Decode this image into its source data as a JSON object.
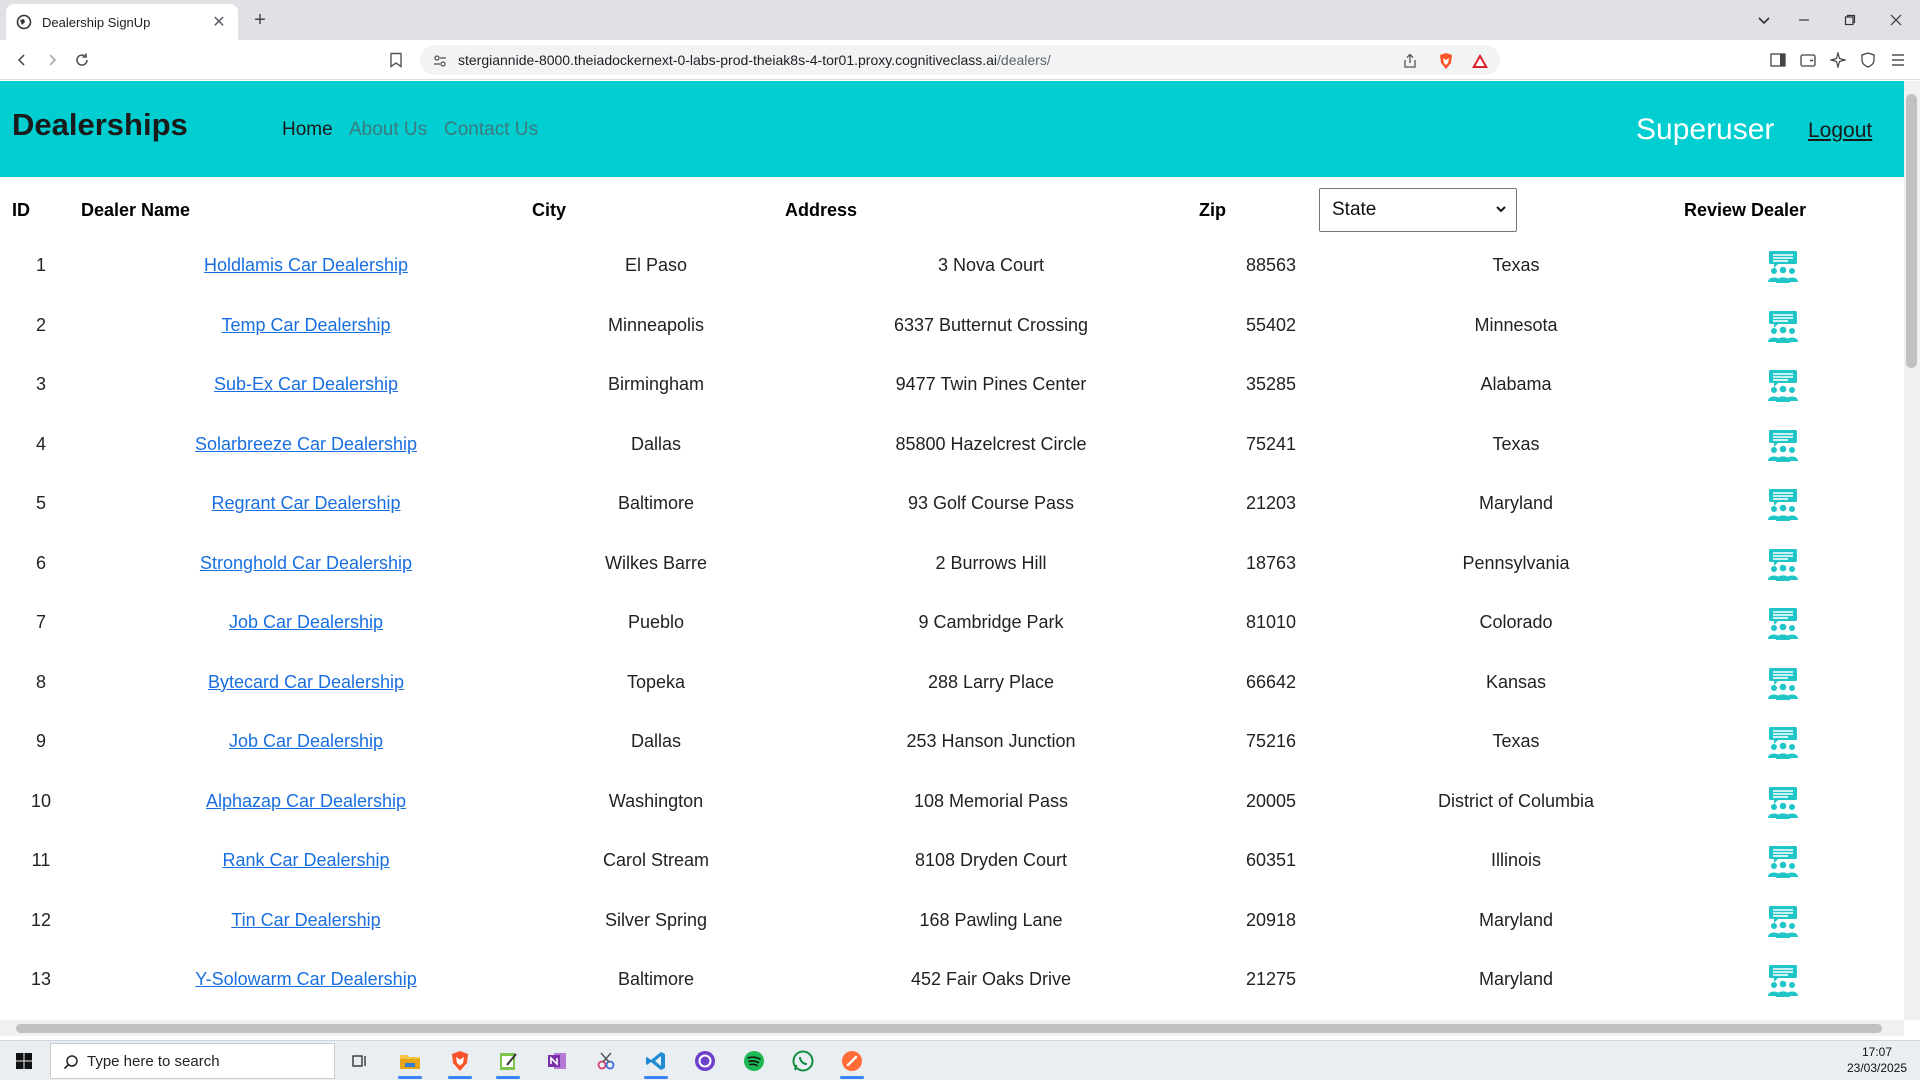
{
  "browser": {
    "tab_title": "Dealership SignUp",
    "url_host": "stergiannide-8000.theiadockernext-0-labs-prod-theiak8s-4-tor01.proxy.cognitiveclass.ai",
    "url_path": "/dealers/"
  },
  "header": {
    "brand": "Dealerships",
    "nav": [
      "Home",
      "About Us",
      "Contact Us"
    ],
    "user": "Superuser",
    "logout": "Logout",
    "bg_color": "#00ced1"
  },
  "table": {
    "headers": {
      "id": "ID",
      "name": "Dealer Name",
      "city": "City",
      "address": "Address",
      "zip": "Zip",
      "state_select": "State",
      "review": "Review Dealer"
    },
    "rows": [
      {
        "id": "1",
        "name": "Holdlamis Car Dealership",
        "city": "El Paso",
        "address": "3 Nova Court",
        "zip": "88563",
        "state": "Texas"
      },
      {
        "id": "2",
        "name": "Temp Car Dealership",
        "city": "Minneapolis",
        "address": "6337 Butternut Crossing",
        "zip": "55402",
        "state": "Minnesota"
      },
      {
        "id": "3",
        "name": "Sub-Ex Car Dealership",
        "city": "Birmingham",
        "address": "9477 Twin Pines Center",
        "zip": "35285",
        "state": "Alabama"
      },
      {
        "id": "4",
        "name": "Solarbreeze Car Dealership",
        "city": "Dallas",
        "address": "85800 Hazelcrest Circle",
        "zip": "75241",
        "state": "Texas"
      },
      {
        "id": "5",
        "name": "Regrant Car Dealership",
        "city": "Baltimore",
        "address": "93 Golf Course Pass",
        "zip": "21203",
        "state": "Maryland"
      },
      {
        "id": "6",
        "name": "Stronghold Car Dealership",
        "city": "Wilkes Barre",
        "address": "2 Burrows Hill",
        "zip": "18763",
        "state": "Pennsylvania"
      },
      {
        "id": "7",
        "name": "Job Car Dealership",
        "city": "Pueblo",
        "address": "9 Cambridge Park",
        "zip": "81010",
        "state": "Colorado"
      },
      {
        "id": "8",
        "name": "Bytecard Car Dealership",
        "city": "Topeka",
        "address": "288 Larry Place",
        "zip": "66642",
        "state": "Kansas"
      },
      {
        "id": "9",
        "name": "Job Car Dealership",
        "city": "Dallas",
        "address": "253 Hanson Junction",
        "zip": "75216",
        "state": "Texas"
      },
      {
        "id": "10",
        "name": "Alphazap Car Dealership",
        "city": "Washington",
        "address": "108 Memorial Pass",
        "zip": "20005",
        "state": "District of Columbia"
      },
      {
        "id": "11",
        "name": "Rank Car Dealership",
        "city": "Carol Stream",
        "address": "8108 Dryden Court",
        "zip": "60351",
        "state": "Illinois"
      },
      {
        "id": "12",
        "name": "Tin Car Dealership",
        "city": "Silver Spring",
        "address": "168 Pawling Lane",
        "zip": "20918",
        "state": "Maryland"
      },
      {
        "id": "13",
        "name": "Y-Solowarm Car Dealership",
        "city": "Baltimore",
        "address": "452 Fair Oaks Drive",
        "zip": "21275",
        "state": "Maryland"
      }
    ],
    "review_icon": "review-people-icon",
    "link_color": "#1a6fe0",
    "icon_color": "#20c5c8"
  },
  "taskbar": {
    "search_placeholder": "Type here to search",
    "time": "17:07",
    "date": "23/03/2025"
  }
}
